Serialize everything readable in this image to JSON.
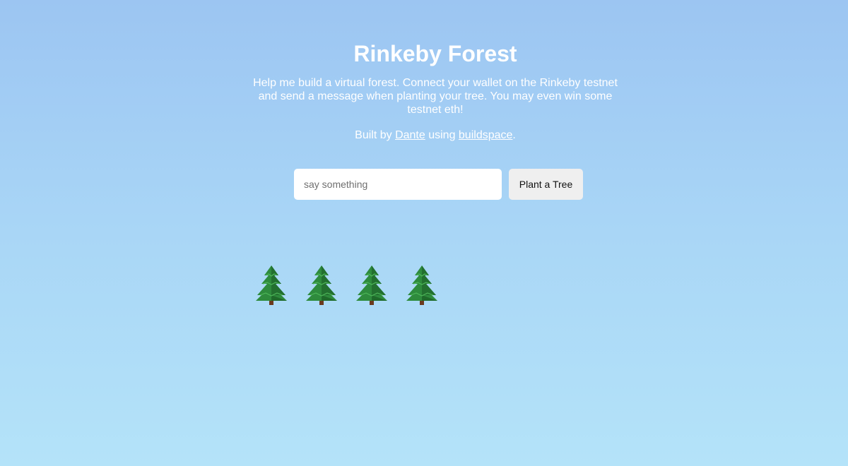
{
  "header": {
    "title": "Rinkeby Forest",
    "description": "Help me build a virtual forest. Connect your wallet on the Rinkeby testnet and send a message when planting your tree. You may even win some testnet eth!",
    "byline_prefix": "Built by ",
    "author_link": "Dante",
    "byline_middle": " using ",
    "tool_link": "buildspace",
    "byline_suffix": "."
  },
  "form": {
    "input_placeholder": "say something",
    "input_value": "",
    "button_label": "Plant a Tree"
  },
  "forest": {
    "tree_count": 4,
    "tree_icon": "evergreen-tree-icon"
  },
  "colors": {
    "background_top": "#9cc5f2",
    "background_bottom": "#b4e3f9",
    "text": "#ffffff",
    "button_bg": "#efefef"
  }
}
